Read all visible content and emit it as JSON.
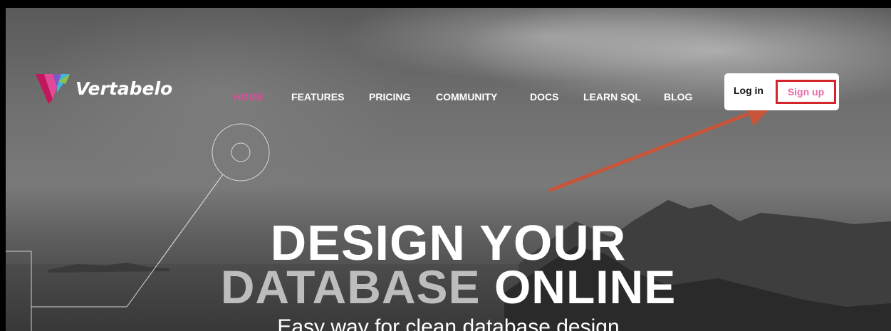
{
  "brand": {
    "name": "Vertabelo"
  },
  "nav": {
    "items": [
      {
        "label": "HOME",
        "active": true
      },
      {
        "label": "FEATURES",
        "active": false
      },
      {
        "label": "PRICING",
        "active": false
      },
      {
        "label": "COMMUNITY",
        "active": false
      },
      {
        "label": "DOCS",
        "active": false
      },
      {
        "label": "LEARN SQL",
        "active": false
      },
      {
        "label": "BLOG",
        "active": false
      }
    ]
  },
  "auth": {
    "login_label": "Log in",
    "signup_label": "Sign up"
  },
  "hero": {
    "line1": "DESIGN YOUR",
    "line2_dim": "DATABASE",
    "line2_bright": "ONLINE",
    "subtitle": "Easy way for clean database design"
  },
  "colors": {
    "accent_pink": "#e04a9a",
    "highlight_red": "#d2262c",
    "arrow": "#c8553a"
  },
  "icons": {
    "logo": "vertabelo-logo-icon",
    "deco": "circle-target-decoration",
    "arrow": "annotation-arrow"
  }
}
